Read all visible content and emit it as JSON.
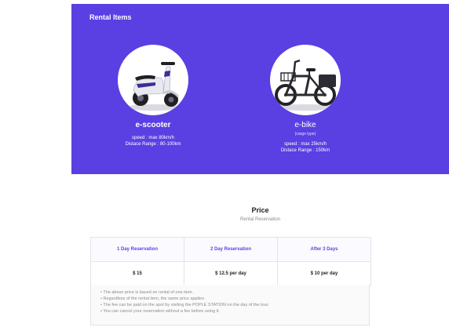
{
  "hero": {
    "title": "Rental Items",
    "background": "#5a3fe3",
    "items": [
      {
        "name": "e-scooter",
        "sub": "",
        "speed": "speed : max 80km/h",
        "range": "Distace Range : 80-100km",
        "image": "scooter-photo"
      },
      {
        "name": "e-bike",
        "sub": "(cargo type)",
        "speed": "speed : max 25km/h",
        "range": "Distace Range : 150km",
        "image": "cargo-ebike-photo"
      }
    ]
  },
  "price": {
    "title": "Price",
    "subtitle": "Rental Reservation",
    "headers": [
      "1 Day Reservation",
      "2 Day Reservation",
      "After 3 Days"
    ],
    "values": [
      "$ 15",
      "$ 12.5 per day",
      "$ 10 per day"
    ],
    "accent": "#5a3fe3"
  },
  "notes": [
    "The above price is based on rental of one item.",
    "Regardless of the rental item, the same price applies.",
    "The fee can be paid on the spot by visiting the POPLE STATION on the day of the tour.",
    "You can cancel your reservation without a fee before using it."
  ]
}
